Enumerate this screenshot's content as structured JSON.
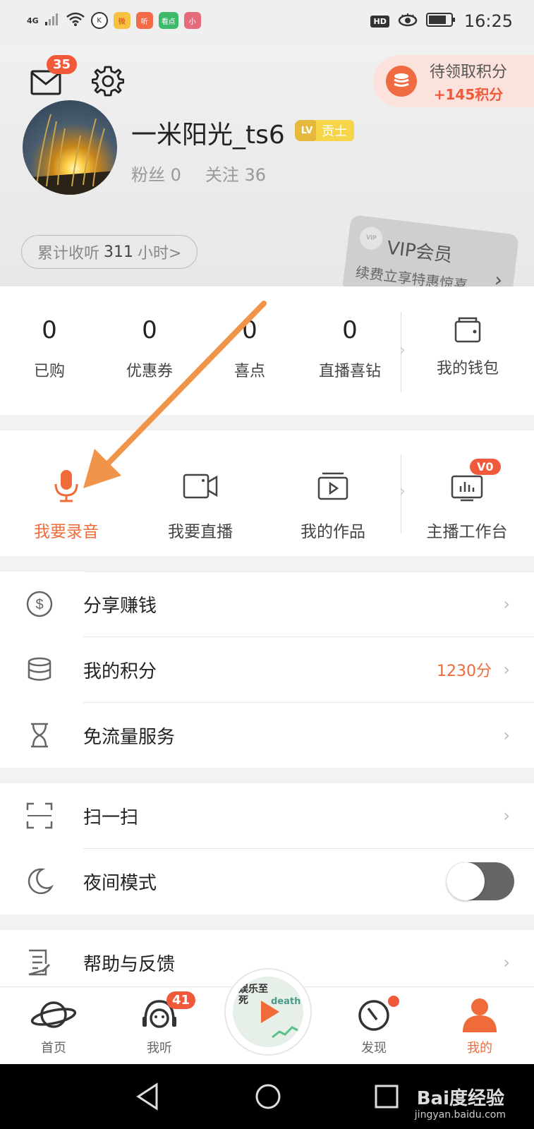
{
  "status": {
    "network": "4G",
    "time": "16:25",
    "hd": "HD",
    "apps": [
      "K",
      "微",
      "听",
      "看点",
      "小"
    ]
  },
  "header": {
    "mail_badge": "35",
    "pending_points": {
      "title": "待领取积分",
      "amount": "+145积分"
    },
    "username": "一米阳光_ts6",
    "level": {
      "icon": "LV",
      "title": "贡士"
    },
    "fans": "粉丝 0",
    "following": "关注 36",
    "listen": {
      "prefix": "累计收听",
      "hours": "311",
      "suffix": "小时>"
    },
    "vip": {
      "title": "VIP会员",
      "subtitle": "续费立享特惠惊喜",
      "seal": "VIP"
    }
  },
  "account": [
    {
      "value": "0",
      "label": "已购"
    },
    {
      "value": "0",
      "label": "优惠券"
    },
    {
      "value": "0",
      "label": "喜点"
    },
    {
      "value": "0",
      "label": "直播喜钻"
    }
  ],
  "wallet_label": "我的钱包",
  "tools": [
    {
      "label": "我要录音",
      "icon": "microphone-icon"
    },
    {
      "label": "我要直播",
      "icon": "video-camera-icon"
    },
    {
      "label": "我的作品",
      "icon": "works-icon"
    }
  ],
  "studio": {
    "label": "主播工作台",
    "badge": "V0"
  },
  "menu": [
    {
      "label": "分享赚钱",
      "icon": "share-money-icon"
    },
    {
      "label": "我的积分",
      "icon": "points-coins-icon",
      "value": "1230分"
    },
    {
      "label": "免流量服务",
      "icon": "hourglass-icon"
    },
    {
      "label": "扫一扫",
      "icon": "scan-icon"
    },
    {
      "label": "夜间模式",
      "icon": "moon-icon",
      "toggle": false
    },
    {
      "label": "帮助与反馈",
      "icon": "feedback-icon"
    }
  ],
  "tabs": [
    {
      "label": "首页",
      "icon": "planet-icon"
    },
    {
      "label": "我听",
      "icon": "headphones-icon",
      "badge": "41"
    },
    {
      "label": "发现",
      "icon": "compass-icon"
    },
    {
      "label": "我的",
      "icon": "person-icon",
      "active": true
    }
  ],
  "player": {
    "cover_text": "娱乐至死",
    "cover_word": "death"
  },
  "watermark": {
    "brand": "Bai度经验",
    "url": "jingyan.baidu.com"
  },
  "colors": {
    "accent": "#f06b3a",
    "text": "#222222",
    "muted": "#999999"
  }
}
